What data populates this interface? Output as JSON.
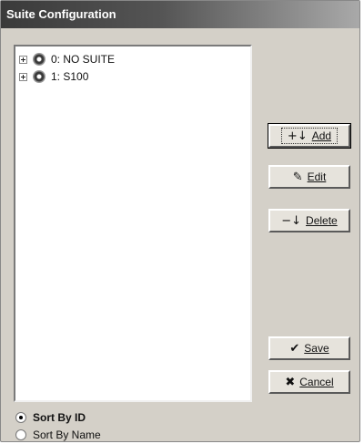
{
  "window": {
    "title": "Suite Configuration"
  },
  "tree": {
    "items": [
      {
        "label": "0: NO SUITE",
        "icon": "suite-disc-icon"
      },
      {
        "label": "1: S100",
        "icon": "suite-disc-icon"
      }
    ]
  },
  "buttons": {
    "add": {
      "label": "Add",
      "icon": "add-icon"
    },
    "edit": {
      "label": "Edit",
      "icon": "edit-icon"
    },
    "delete": {
      "label": "Delete",
      "icon": "delete-icon"
    },
    "save": {
      "label": "Save",
      "icon": "checkmark-icon"
    },
    "cancel": {
      "label": "Cancel",
      "icon": "x-icon"
    }
  },
  "sort": {
    "options": [
      {
        "label": "Sort By ID",
        "selected": true
      },
      {
        "label": "Sort By Name",
        "selected": false
      }
    ]
  }
}
